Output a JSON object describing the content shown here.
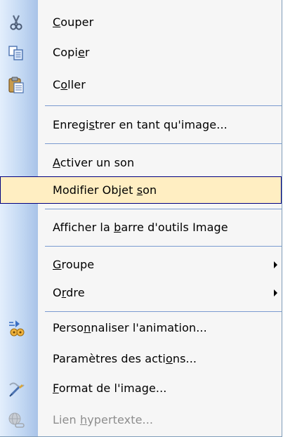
{
  "menu": {
    "items": [
      {
        "label_pre": "",
        "label_key": "C",
        "label_post": "ouper",
        "icon": "scissors-icon"
      },
      {
        "label_pre": "Copi",
        "label_key": "e",
        "label_post": "r",
        "icon": "copy-icon"
      },
      {
        "label_pre": "C",
        "label_key": "o",
        "label_post": "ller",
        "icon": "paste-icon"
      },
      {
        "label_pre": "Enregi",
        "label_key": "s",
        "label_post": "trer en tant qu'image...",
        "icon": ""
      },
      {
        "label_pre": "",
        "label_key": "A",
        "label_post": "ctiver un son",
        "icon": ""
      },
      {
        "label_pre": "Modifier Objet ",
        "label_key": "s",
        "label_post": "on",
        "icon": ""
      },
      {
        "label_pre": "Afficher la ",
        "label_key": "b",
        "label_post": "arre d'outils Image",
        "icon": ""
      },
      {
        "label_pre": "",
        "label_key": "G",
        "label_post": "roupe",
        "icon": "",
        "submenu": true
      },
      {
        "label_pre": "O",
        "label_key": "r",
        "label_post": "dre",
        "icon": "",
        "submenu": true
      },
      {
        "label_pre": "Perso",
        "label_key": "n",
        "label_post": "naliser l'animation...",
        "icon": "custom-animation-icon"
      },
      {
        "label_pre": "Paramètres des acti",
        "label_key": "o",
        "label_post": "ns...",
        "icon": ""
      },
      {
        "label_pre": "",
        "label_key": "F",
        "label_post": "ormat de l'image...",
        "icon": "format-picture-icon"
      },
      {
        "label_pre": "Lien ",
        "label_key": "h",
        "label_post": "ypertexte...",
        "icon": "hyperlink-icon",
        "disabled": true
      }
    ],
    "highlighted_index": 5,
    "colors": {
      "highlight_bg": "#ffeec2",
      "highlight_border": "#000080",
      "gutter": "#c4d9f3",
      "disabled_text": "#8d8d8d"
    }
  }
}
